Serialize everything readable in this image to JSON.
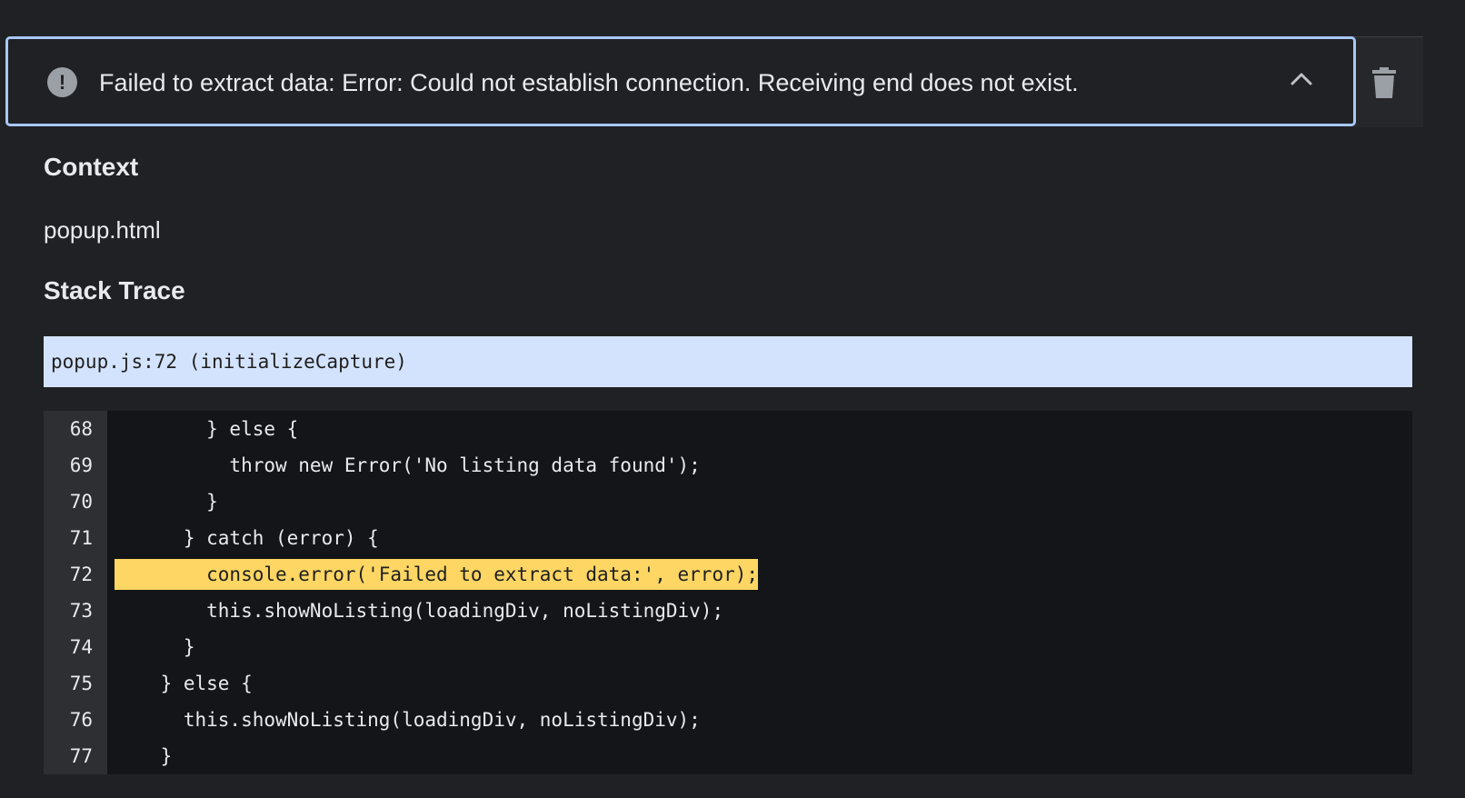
{
  "error": {
    "message": "Failed to extract data: Error: Could not establish connection. Receiving end does not exist.",
    "icon": "exclamation-icon",
    "icon_glyph": "!",
    "toggle_icon": "chevron-up-icon",
    "delete_icon": "trash-icon"
  },
  "details": {
    "context_heading": "Context",
    "context_value": "popup.html",
    "stack_heading": "Stack Trace",
    "stack_frame": "popup.js:72 (initializeCapture)"
  },
  "code": {
    "highlighted_line": 72,
    "lines": [
      {
        "number": "68",
        "text": "        } else {"
      },
      {
        "number": "69",
        "text": "          throw new Error('No listing data found');"
      },
      {
        "number": "70",
        "text": "        }"
      },
      {
        "number": "71",
        "text": "      } catch (error) {"
      },
      {
        "number": "72",
        "text": "        console.error('Failed to extract data:', error);"
      },
      {
        "number": "73",
        "text": "        this.showNoListing(loadingDiv, noListingDiv);"
      },
      {
        "number": "74",
        "text": "      }"
      },
      {
        "number": "75",
        "text": "    } else {"
      },
      {
        "number": "76",
        "text": "      this.showNoListing(loadingDiv, noListingDiv);"
      },
      {
        "number": "77",
        "text": "    }"
      }
    ]
  },
  "colors": {
    "background": "#202124",
    "focus_border": "#a8c7fa",
    "stack_frame_background": "#d3e3fd",
    "code_background": "#141518",
    "gutter_background": "#2d2f33",
    "highlight": "#fdd663"
  }
}
